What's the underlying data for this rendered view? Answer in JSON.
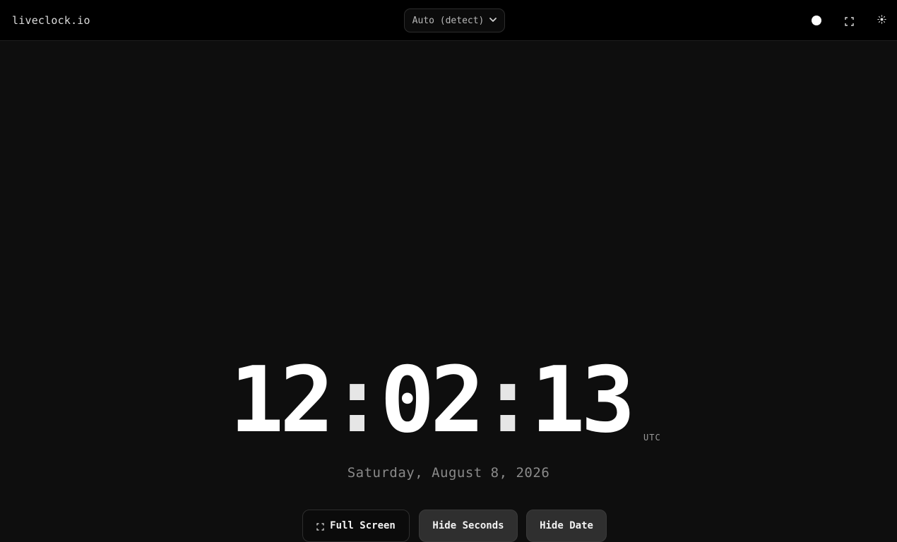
{
  "header": {
    "brand": "liveclock.io",
    "timezone_select": {
      "selected": "Auto (detect)"
    },
    "icons": [
      "dot-icon",
      "fullscreen-icon",
      "sun-icon"
    ]
  },
  "clock": {
    "hours": "12",
    "minutes": "02",
    "seconds": "13",
    "separator": ":",
    "timezone": "UTC",
    "date": "Saturday, August 8, 2026"
  },
  "actions": {
    "full_screen": "Full Screen",
    "hide_seconds": "Hide Seconds",
    "hide_date": "Hide Date"
  },
  "colors": {
    "background": "#0e0e0e",
    "topbar": "#000000",
    "clock_text": "#ffffff",
    "date_text": "#8a8a8a",
    "button_filled": "#2f2f2f"
  }
}
